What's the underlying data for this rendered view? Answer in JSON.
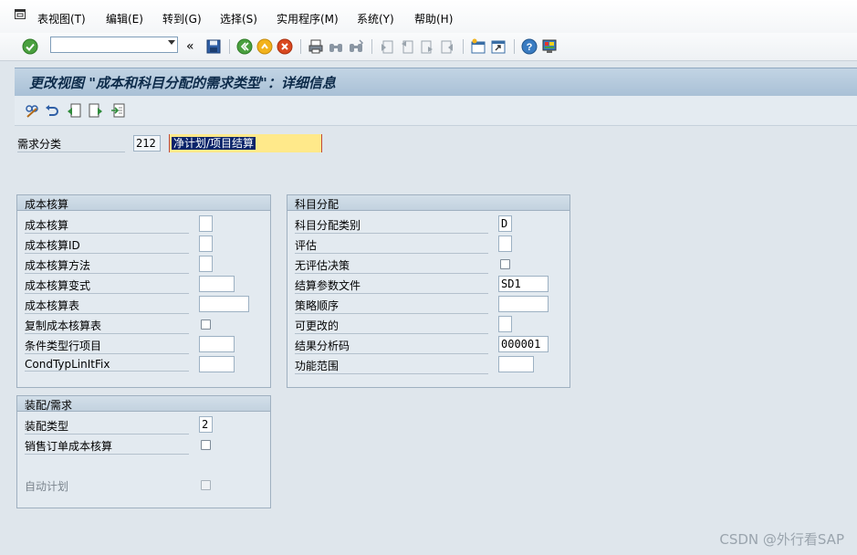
{
  "menubar": {
    "items": [
      "表视图(T)",
      "编辑(E)",
      "转到(G)",
      "选择(S)",
      "实用程序(M)",
      "系统(Y)",
      "帮助(H)"
    ]
  },
  "toolbar": {
    "command_field": "",
    "icons": [
      "enter-icon",
      "history-icon",
      "save-icon",
      "back-icon",
      "exit-icon",
      "cancel-icon",
      "print-icon",
      "find-icon",
      "find-next-icon",
      "first-page-icon",
      "previous-page-icon",
      "next-page-icon",
      "last-page-icon",
      "new-session-icon",
      "shortcut-icon",
      "help-icon",
      "layout-icon"
    ]
  },
  "title": "更改视图 \"成本和科目分配的需求类型\"：详细信息",
  "app_toolbar": {
    "icons": [
      "display-change-icon",
      "undo-icon",
      "previous-entry-icon",
      "next-entry-icon",
      "variable-list-icon"
    ]
  },
  "requirements_class": {
    "label": "需求分类",
    "code": "212",
    "description": "净计划/项目结算"
  },
  "costing": {
    "title": "成本核算",
    "fields": [
      {
        "label": "成本核算",
        "value": ""
      },
      {
        "label": "成本核算ID",
        "value": ""
      },
      {
        "label": "成本核算方法",
        "value": ""
      },
      {
        "label": "成本核算变式",
        "value": ""
      },
      {
        "label": "成本核算表",
        "value": ""
      },
      {
        "label": "复制成本核算表",
        "checked": false
      },
      {
        "label": "条件类型行项目",
        "value": ""
      },
      {
        "label": "CondTypLinItFix",
        "value": ""
      }
    ]
  },
  "assignment": {
    "title": "科目分配",
    "fields": [
      {
        "label": "科目分配类别",
        "value": "D"
      },
      {
        "label": "评估",
        "value": ""
      },
      {
        "label": "无评估决策",
        "checked": false
      },
      {
        "label": "结算参数文件",
        "value": "SD1"
      },
      {
        "label": "策略顺序",
        "value": ""
      },
      {
        "label": "可更改的",
        "value": ""
      },
      {
        "label": "结果分析码",
        "value": "000001"
      },
      {
        "label": "功能范围",
        "value": ""
      }
    ]
  },
  "config": {
    "title": "装配/需求",
    "fields": [
      {
        "label": "装配类型",
        "value": "2"
      },
      {
        "label": "销售订单成本核算",
        "checked": false
      },
      {
        "label": "自动计划",
        "checked": false,
        "disabled": true
      }
    ]
  },
  "watermark": "CSDN @外行看SAP"
}
